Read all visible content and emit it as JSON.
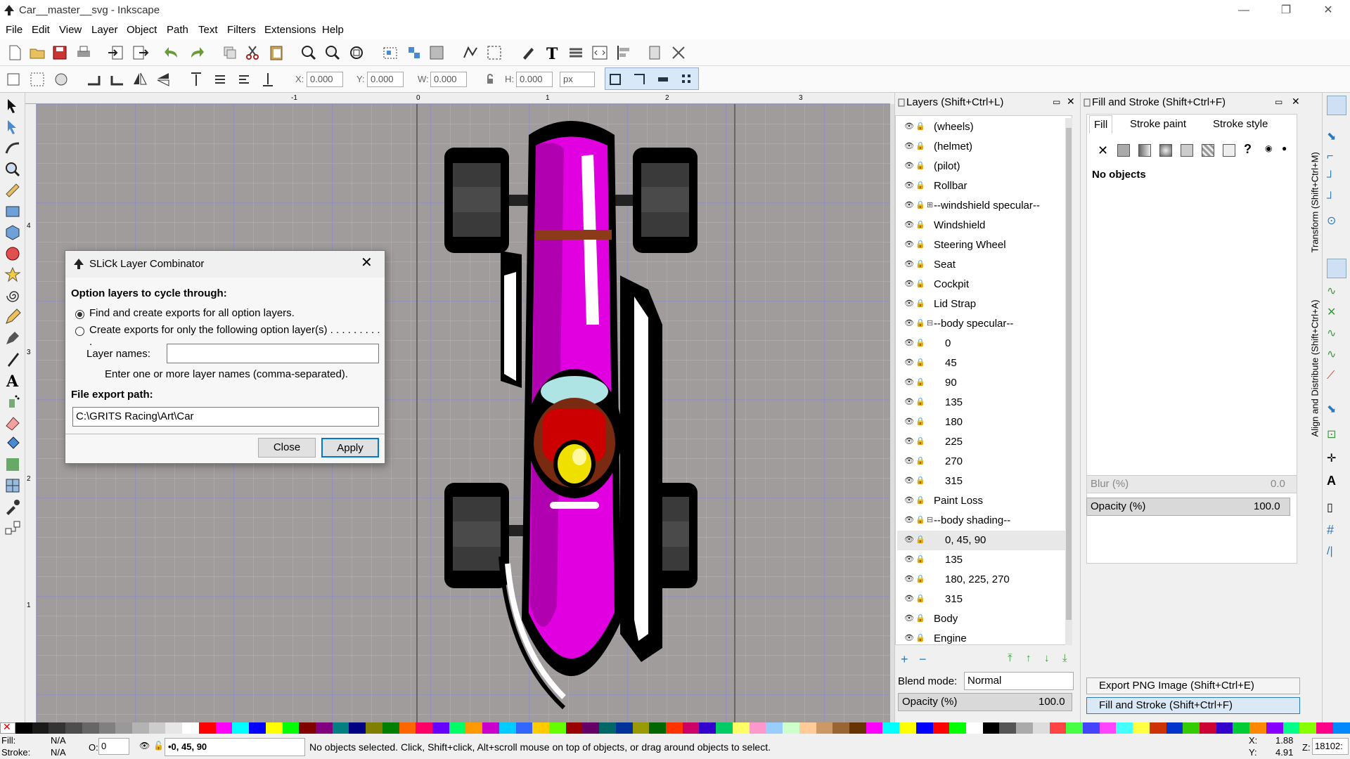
{
  "window": {
    "title": "Car__master__svg - Inkscape",
    "minimize": "—",
    "maximize": "❐",
    "close": "✕"
  },
  "menu": [
    "File",
    "Edit",
    "View",
    "Layer",
    "Object",
    "Path",
    "Text",
    "Filters",
    "Extensions",
    "Help"
  ],
  "controls": {
    "x_label": "X:",
    "x_value": "0.000",
    "y_label": "Y:",
    "y_value": "0.000",
    "w_label": "W:",
    "w_value": "0.000",
    "h_label": "H:",
    "h_value": "0.000",
    "unit": "px"
  },
  "ruler": {
    "top_ticks": [
      "-1",
      "0",
      "1",
      "2",
      "3"
    ],
    "left_ticks": [
      "4",
      "3",
      "2",
      "1"
    ]
  },
  "layers_panel": {
    "title": "Layers (Shift+Ctrl+L)",
    "layers": [
      {
        "name": "(wheels)",
        "indent": 0,
        "expander": ""
      },
      {
        "name": "(helmet)",
        "indent": 0,
        "expander": ""
      },
      {
        "name": "(pilot)",
        "indent": 0,
        "expander": ""
      },
      {
        "name": "Rollbar",
        "indent": 0,
        "expander": ""
      },
      {
        "name": "--windshield specular--",
        "indent": 0,
        "expander": "⊞"
      },
      {
        "name": "Windshield",
        "indent": 0,
        "expander": ""
      },
      {
        "name": "Steering Wheel",
        "indent": 0,
        "expander": ""
      },
      {
        "name": "Seat",
        "indent": 0,
        "expander": ""
      },
      {
        "name": "Cockpit",
        "indent": 0,
        "expander": ""
      },
      {
        "name": "Lid Strap",
        "indent": 0,
        "expander": ""
      },
      {
        "name": "--body specular--",
        "indent": 0,
        "expander": "⊟"
      },
      {
        "name": "0",
        "indent": 1,
        "expander": ""
      },
      {
        "name": "45",
        "indent": 1,
        "expander": ""
      },
      {
        "name": "90",
        "indent": 1,
        "expander": ""
      },
      {
        "name": "135",
        "indent": 1,
        "expander": ""
      },
      {
        "name": "180",
        "indent": 1,
        "expander": ""
      },
      {
        "name": "225",
        "indent": 1,
        "expander": ""
      },
      {
        "name": "270",
        "indent": 1,
        "expander": ""
      },
      {
        "name": "315",
        "indent": 1,
        "expander": ""
      },
      {
        "name": "Paint Loss",
        "indent": 0,
        "expander": ""
      },
      {
        "name": "--body shading--",
        "indent": 0,
        "expander": "⊟"
      },
      {
        "name": "0, 45, 90",
        "indent": 1,
        "expander": "",
        "selected": true
      },
      {
        "name": "135",
        "indent": 1,
        "expander": ""
      },
      {
        "name": "180, 225, 270",
        "indent": 1,
        "expander": ""
      },
      {
        "name": "315",
        "indent": 1,
        "expander": ""
      },
      {
        "name": "Body",
        "indent": 0,
        "expander": ""
      },
      {
        "name": "Engine",
        "indent": 0,
        "expander": ""
      }
    ],
    "blend_label": "Blend mode:",
    "blend_value": "Normal",
    "opacity_label": "Opacity (%)",
    "opacity_value": "100.0"
  },
  "fill_stroke": {
    "title": "Fill and Stroke (Shift+Ctrl+F)",
    "tabs": [
      "Fill",
      "Stroke paint",
      "Stroke style"
    ],
    "status": "No objects",
    "blur_label": "Blur (%)",
    "blur_value": "0.0",
    "opacity_label": "Opacity (%)",
    "opacity_value": "100.0",
    "export_png": "Export PNG Image (Shift+Ctrl+E)",
    "fill_stroke_tab": "Fill and Stroke (Shift+Ctrl+F)"
  },
  "dock_vertical": {
    "transform": "Transform (Shift+Ctrl+M)",
    "align": "Align and Distribute (Shift+Ctrl+A)"
  },
  "dialog": {
    "title": "SLiCk Layer Combinator",
    "section1": "Option layers to cycle through:",
    "radio1": "Find and create exports for all option layers.",
    "radio2": "Create exports for only the following option layer(s) . . . . . . . . . .",
    "layer_names_label": "Layer names:",
    "layer_names_value": "",
    "hint": "Enter one or more layer names (comma-separated).",
    "section2": "File export path:",
    "export_path": "C:\\GRITS Racing\\Art\\Car",
    "close": "Close",
    "apply": "Apply"
  },
  "status": {
    "fill_label": "Fill:",
    "fill_value": "N/A",
    "stroke_label": "Stroke:",
    "stroke_value": "N/A",
    "o_label": "O:",
    "o_value": "0",
    "layer": "•0, 45, 90",
    "message": "No objects selected. Click, Shift+click, Alt+scroll mouse on top of objects, or drag around objects to select.",
    "x_label": "X:",
    "x_value": "1.88",
    "y_label": "Y:",
    "y_value": "4.91",
    "z_label": "Z:",
    "z_value": "18102:"
  },
  "palette": [
    "#000000",
    "#1a1a1a",
    "#333333",
    "#4d4d4d",
    "#666666",
    "#808080",
    "#999999",
    "#b3b3b3",
    "#cccccc",
    "#e6e6e6",
    "#ffffff",
    "#ff0000",
    "#ff00ff",
    "#00ffff",
    "#0000ff",
    "#ffff00",
    "#00ff00",
    "#800000",
    "#800080",
    "#008080",
    "#000080",
    "#808000",
    "#008000",
    "#ff6600",
    "#ff0066",
    "#6600ff",
    "#00ff66",
    "#ff9900",
    "#cc00cc",
    "#00ccff",
    "#3366ff",
    "#ffcc00",
    "#66ff00",
    "#990000",
    "#660066",
    "#006666",
    "#003399",
    "#999900",
    "#006600",
    "#ff3300",
    "#cc0066",
    "#3300cc",
    "#00cc66",
    "#ffff66",
    "#ff99cc",
    "#99ccff",
    "#ccffcc",
    "#ffcc99",
    "#cc9966",
    "#996633",
    "#663300",
    "#ff00ff",
    "#00ffff",
    "#ffff00",
    "#0000ff",
    "#ff0000",
    "#00ff00",
    "#ffffff",
    "#000000",
    "#555555",
    "#aaaaaa",
    "#dddddd",
    "#ff4444",
    "#44ff44",
    "#4444ff",
    "#ff44ff",
    "#44ffff",
    "#ffff44",
    "#cc3300",
    "#0033cc",
    "#33cc00",
    "#cc0033",
    "#3300cc",
    "#00cc33",
    "#ff8800",
    "#8800ff",
    "#00ff88",
    "#88ff00",
    "#ff0088",
    "#0088ff"
  ]
}
